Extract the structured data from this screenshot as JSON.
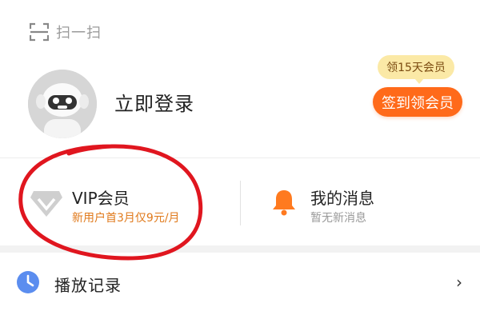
{
  "header": {
    "scan_label": "扫一扫",
    "scan_icon": "scan-frame-icon"
  },
  "profile": {
    "login_label": "立即登录",
    "reward_bubble": "领15天会员",
    "checkin_label": "签到领会员",
    "accent_color": "#ff6a1a",
    "bubble_color": "#fbe9a6"
  },
  "cards": {
    "vip": {
      "title": "VIP会员",
      "subtitle": "新用户首3月仅9元/月",
      "icon": "vip-diamond-icon"
    },
    "messages": {
      "title": "我的消息",
      "subtitle": "暂无新消息",
      "icon": "bell-icon"
    }
  },
  "menu": {
    "history": {
      "label": "播放记录",
      "icon": "clock-icon",
      "chevron": "›"
    }
  },
  "annotation": {
    "ellipse_color": "#e0161f"
  }
}
